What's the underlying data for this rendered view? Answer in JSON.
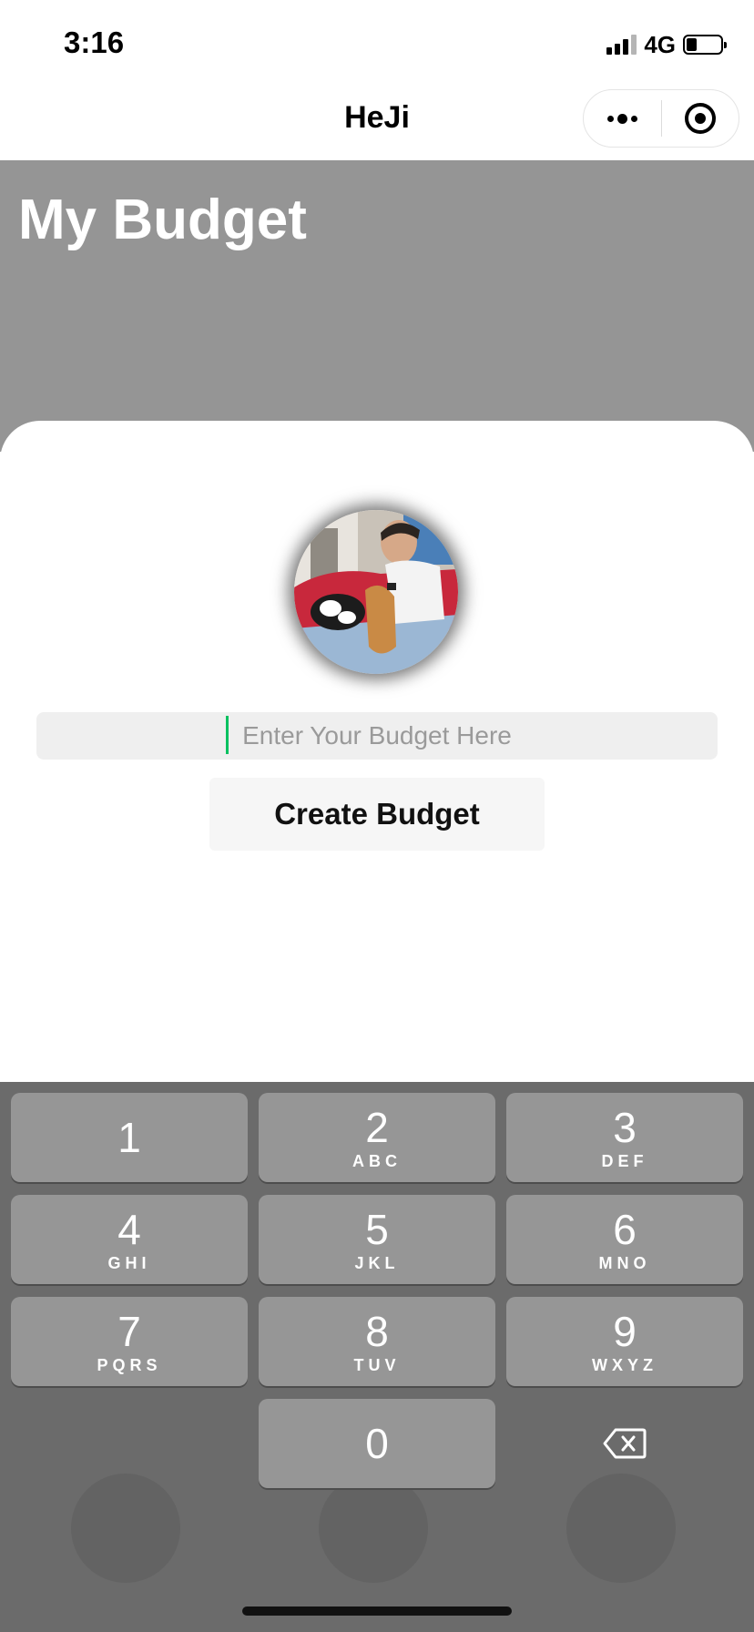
{
  "status_bar": {
    "time": "3:16",
    "network": "4G",
    "battery_level": 0.3
  },
  "nav": {
    "title": "HeJi",
    "more_icon": "more-dots-icon",
    "close_icon": "target-circle-icon"
  },
  "page": {
    "title": "My Budget"
  },
  "form": {
    "budget_placeholder": "Enter Your Budget Here",
    "budget_value": "",
    "create_label": "Create Budget"
  },
  "keypad": {
    "keys": [
      {
        "num": "1",
        "letters": ""
      },
      {
        "num": "2",
        "letters": "ABC"
      },
      {
        "num": "3",
        "letters": "DEF"
      },
      {
        "num": "4",
        "letters": "GHI"
      },
      {
        "num": "5",
        "letters": "JKL"
      },
      {
        "num": "6",
        "letters": "MNO"
      },
      {
        "num": "7",
        "letters": "PQRS"
      },
      {
        "num": "8",
        "letters": "TUV"
      },
      {
        "num": "9",
        "letters": "WXYZ"
      },
      {
        "num": "0",
        "letters": ""
      }
    ],
    "delete_icon": "backspace-icon"
  },
  "colors": {
    "header_gray": "#959595",
    "keypad_bg": "#6b6b6b",
    "key_bg": "#969696",
    "caret": "#07c160"
  }
}
